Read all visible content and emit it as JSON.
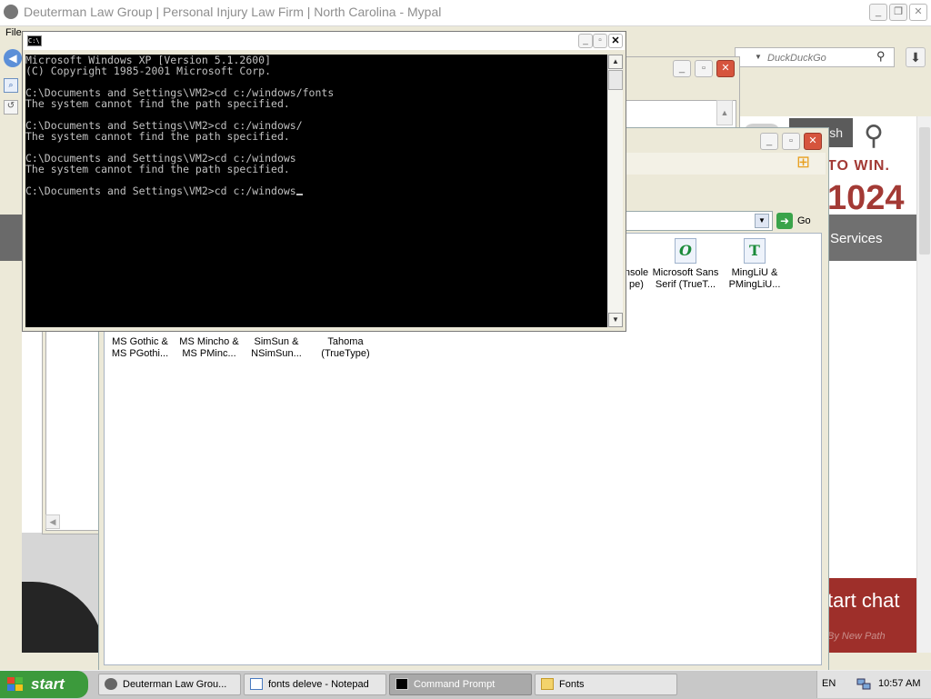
{
  "browser": {
    "title": "Deuterman Law Group | Personal Injury Law Firm | North Carolina - Mypal",
    "menu_file": "File",
    "search_placeholder": "DuckDuckGo"
  },
  "website": {
    "english_tab": "lish",
    "slogan": "TO WIN.",
    "phone": "1024",
    "services": "Services",
    "chat": "tart chat",
    "chat_sub": "By New Path"
  },
  "fonts_window": {
    "go_label": "Go",
    "items_row1": [
      {
        "name": "nsole\npe)",
        "icon": "font-file-icon"
      },
      {
        "name": "Microsoft Sans\nSerif (TrueT...",
        "icon": "opentype-font-icon"
      },
      {
        "name": "MingLiU &\nPMingLiU...",
        "icon": "truetype-font-icon"
      }
    ],
    "items_row2": [
      {
        "name": "MS Gothic &\nMS PGothi..."
      },
      {
        "name": "MS Mincho &\nMS PMinc..."
      },
      {
        "name": "SimSun &\nNSimSun..."
      },
      {
        "name": "Tahoma\n(TrueType)"
      }
    ]
  },
  "cmd": {
    "lines": [
      "Microsoft Windows XP [Version 5.1.2600]",
      "(C) Copyright 1985-2001 Microsoft Corp.",
      "",
      "C:\\Documents and Settings\\VM2>cd c:/windows/fonts",
      "The system cannot find the path specified.",
      "",
      "C:\\Documents and Settings\\VM2>cd c:/windows/",
      "The system cannot find the path specified.",
      "",
      "C:\\Documents and Settings\\VM2>cd c:/windows",
      "The system cannot find the path specified.",
      "",
      "C:\\Documents and Settings\\VM2>cd c:/windows"
    ]
  },
  "taskbar": {
    "start_label": "start",
    "tasks": [
      {
        "label": "Deuterman Law Grou...",
        "icon": "browser-icon",
        "active": false
      },
      {
        "label": "fonts deleve - Notepad",
        "icon": "notepad-icon",
        "active": false
      },
      {
        "label": "Command Prompt",
        "icon": "cmd-icon",
        "active": true
      },
      {
        "label": "Fonts",
        "icon": "folder-icon",
        "active": false
      }
    ],
    "language": "EN",
    "clock": "10:57 AM"
  },
  "colors": {
    "site_accent": "#a33a35",
    "start_green": "#3c9a3c",
    "console_bg": "#000000",
    "console_fg": "#c0c0c0"
  }
}
